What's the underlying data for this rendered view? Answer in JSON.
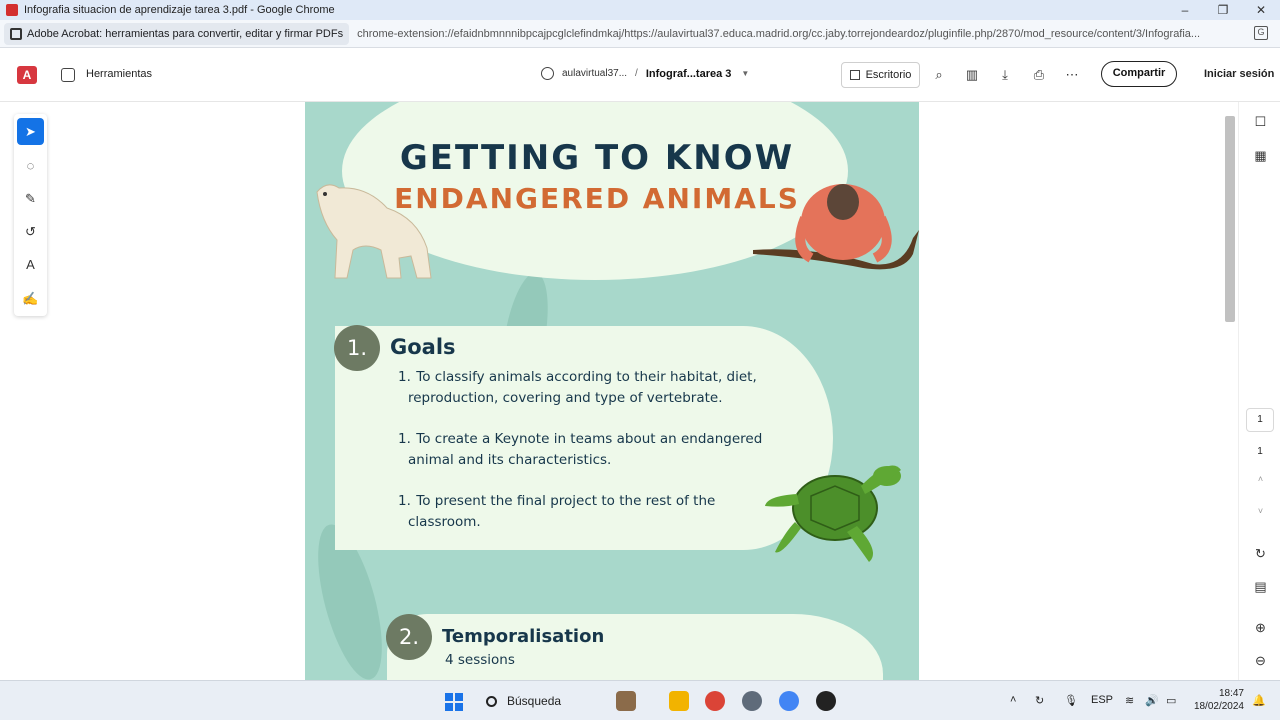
{
  "window": {
    "title": "Infografia situacion de aprendizaje tarea 3.pdf - Google Chrome",
    "controls": [
      "–",
      "❐",
      "✕"
    ]
  },
  "addressbar": {
    "extension_label": "Adobe Acrobat: herramientas para convertir, editar y firmar PDFs",
    "url": "chrome-extension://efaidnbmnnnibpcajpcglclefindmkaj/https://aulavirtual37.educa.madrid.org/cc.jaby.torrejondeardoz/pluginfile.php/2870/mod_resource/content/3/Infografia..."
  },
  "acrobat": {
    "tools_label": "Herramientas",
    "site": "aulavirtual37...",
    "separator": "/",
    "doc_title": "Infograf...tarea 3",
    "open_desktop_label": "Escritorio",
    "share_label": "Compartir",
    "signin_label": "Iniciar sesión"
  },
  "pdf": {
    "title_line1": "GETTING TO KNOW",
    "title_line2": "ENDANGERED ANIMALS",
    "sections": [
      {
        "number": "1.",
        "title": "Goals",
        "items": [
          {
            "n": "1.",
            "line1": "To classify animals according to their habitat, diet,",
            "line2": "reproduction, covering and type of vertebrate."
          },
          {
            "n": "1.",
            "line1": "To create a Keynote in teams about an endangered",
            "line2": "animal and its characteristics."
          },
          {
            "n": "1.",
            "line1": "To present the final project to the rest of the",
            "line2": "classroom."
          }
        ]
      },
      {
        "number": "2.",
        "title": "Temporalisation",
        "subtitle": "4 sessions"
      }
    ]
  },
  "viewer": {
    "current_page": "1",
    "total_pages": "1"
  },
  "taskbar": {
    "search_label": "Búsqueda",
    "language": "ESP",
    "time": "18:47",
    "date": "18/02/2024"
  },
  "colors": {
    "page_bg": "#a8d8cb",
    "card_bg": "#eef9ea",
    "title_dark": "#17374b",
    "title_orange": "#d26a33",
    "accent_blue": "#1473e6"
  }
}
